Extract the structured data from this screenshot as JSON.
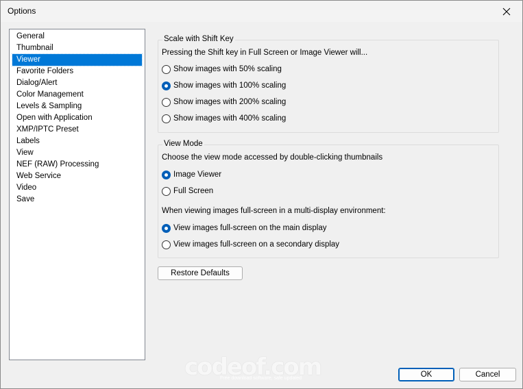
{
  "window": {
    "title": "Options"
  },
  "nav": {
    "items": [
      {
        "label": "General",
        "selected": false
      },
      {
        "label": "Thumbnail",
        "selected": false
      },
      {
        "label": "Viewer",
        "selected": true
      },
      {
        "label": "Favorite Folders",
        "selected": false
      },
      {
        "label": "Dialog/Alert",
        "selected": false
      },
      {
        "label": "Color Management",
        "selected": false
      },
      {
        "label": "Levels & Sampling",
        "selected": false
      },
      {
        "label": "Open with Application",
        "selected": false
      },
      {
        "label": "XMP/IPTC Preset",
        "selected": false
      },
      {
        "label": "Labels",
        "selected": false
      },
      {
        "label": "View",
        "selected": false
      },
      {
        "label": "NEF (RAW) Processing",
        "selected": false
      },
      {
        "label": "Web Service",
        "selected": false
      },
      {
        "label": "Video",
        "selected": false
      },
      {
        "label": "Save",
        "selected": false
      }
    ]
  },
  "scale_group": {
    "legend": "Scale with Shift Key",
    "description": "Pressing the Shift key in Full Screen or Image Viewer will...",
    "options": [
      {
        "label": "Show images with 50% scaling",
        "checked": false
      },
      {
        "label": "Show images with 100% scaling",
        "checked": true
      },
      {
        "label": "Show images with 200% scaling",
        "checked": false
      },
      {
        "label": "Show images with 400% scaling",
        "checked": false
      }
    ]
  },
  "view_mode_group": {
    "legend": "View Mode",
    "description": "Choose the view mode accessed by double-clicking thumbnails",
    "options": [
      {
        "label": "Image Viewer",
        "checked": true
      },
      {
        "label": "Full Screen",
        "checked": false
      }
    ],
    "multi_display_description": "When viewing images full-screen in a multi-display environment:",
    "display_options": [
      {
        "label": "View images full-screen on the main display",
        "checked": true
      },
      {
        "label": "View images full-screen on a secondary display",
        "checked": false
      }
    ]
  },
  "buttons": {
    "restore_defaults": "Restore Defaults",
    "ok": "OK",
    "cancel": "Cancel"
  },
  "watermark": {
    "text": "codeof.com",
    "subtext": "Free download software, safe updated"
  },
  "icons": {
    "close": "close-icon"
  }
}
